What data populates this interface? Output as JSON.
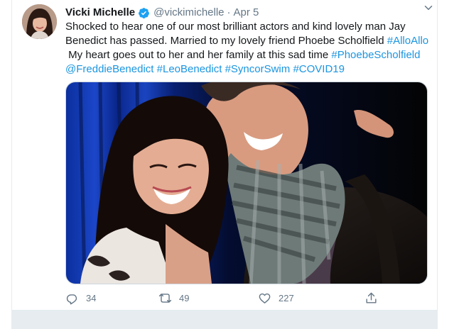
{
  "tweet": {
    "name": "Vicki Michelle",
    "handle": "@vickimichelle",
    "separator": "·",
    "date": "Apr 5",
    "text": {
      "part1": "Shocked to hear one of our most brilliant actors and kind lovely man Jay Benedict has passed. Married to my lovely friend Phoebe Scholfield ",
      "tag_alloallo": "#AlloAllo",
      "part2": "\n My heart goes out to her and her family at this sad time ",
      "tag_phoebe": "#PhoebeScholfield",
      "mention_freddie": "@FreddieBenedict",
      "tag_leo": "#LeoBenedict",
      "tag_syncor": "#SyncorSwim",
      "tag_covid": "#COVID19"
    },
    "stats": {
      "replies": "34",
      "retweets": "49",
      "likes": "227"
    }
  },
  "colors": {
    "link": "#1b95e0",
    "secondary_text": "#657786",
    "verified": "#1da1f2",
    "border": "#e6ecf0"
  },
  "icons": [
    "verified-badge-icon",
    "chevron-down-icon",
    "reply-icon",
    "retweet-icon",
    "like-icon",
    "share-icon"
  ]
}
